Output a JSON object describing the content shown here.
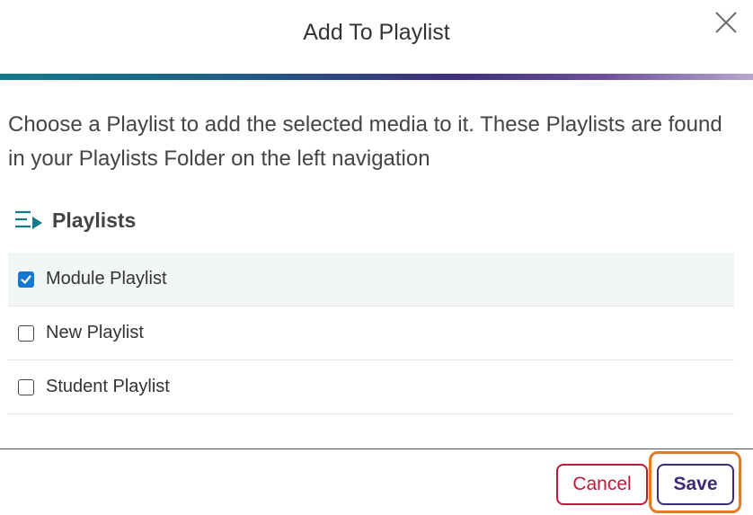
{
  "dialog": {
    "title": "Add To Playlist",
    "close_icon": "close-icon",
    "description": "Choose a Playlist to add the selected media to it. These Playlists are found in your Playlists Folder on the left navigation"
  },
  "section": {
    "title": "Playlists",
    "icon": "playlist-icon"
  },
  "playlists": [
    {
      "label": "Module Playlist",
      "checked": true
    },
    {
      "label": "New Playlist",
      "checked": false
    },
    {
      "label": "Student Playlist",
      "checked": false
    }
  ],
  "footer": {
    "cancel_label": "Cancel",
    "save_label": "Save"
  },
  "colors": {
    "accent_blue": "#1479d4",
    "cancel_red": "#c0183a",
    "save_purple": "#3d2b78",
    "focus_orange": "#e07b26",
    "icon_teal": "#137a8a"
  }
}
